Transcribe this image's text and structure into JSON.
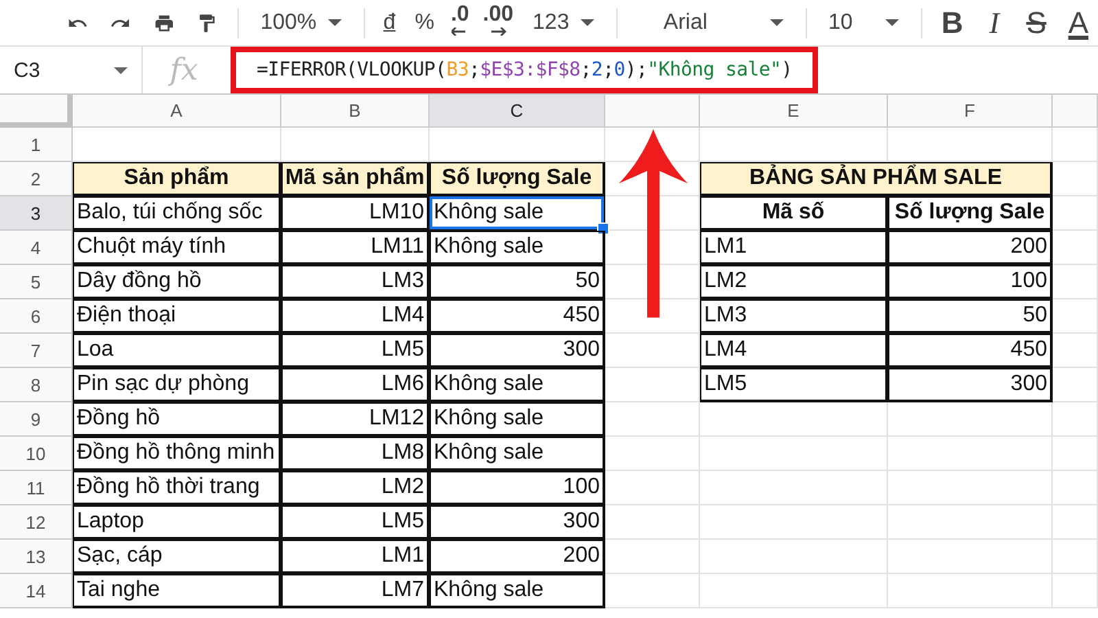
{
  "toolbar": {
    "zoom": "100%",
    "currency": "đ",
    "percent": "%",
    "decrease_decimals": ".0",
    "increase_decimals": ".00",
    "more_formats": "123",
    "font": "Arial",
    "font_size": "10",
    "bold": "B",
    "italic": "I",
    "strikethrough": "S",
    "text_color": "A"
  },
  "formula_bar": {
    "name_box": "C3",
    "fx": "fx",
    "formula": [
      {
        "text": "=IFERROR(VLOOKUP(",
        "color": "#202124"
      },
      {
        "text": "B3",
        "color": "#f09a2a"
      },
      {
        "text": ";",
        "color": "#202124"
      },
      {
        "text": "$E$3:$F$8",
        "color": "#8e44ad"
      },
      {
        "text": ";",
        "color": "#202124"
      },
      {
        "text": "2",
        "color": "#1a56c4"
      },
      {
        "text": ";",
        "color": "#202124"
      },
      {
        "text": "0",
        "color": "#1a56c4"
      },
      {
        "text": ");",
        "color": "#202124"
      },
      {
        "text": "\"Không sale\"",
        "color": "#188038"
      },
      {
        "text": ")",
        "color": "#202124"
      }
    ]
  },
  "column_headers": [
    {
      "label": "A",
      "selected": false
    },
    {
      "label": "B",
      "selected": false
    },
    {
      "label": "C",
      "selected": true
    },
    {
      "selected": false
    },
    {
      "label": "E",
      "selected": false
    },
    {
      "label": "F",
      "selected": false
    }
  ],
  "row_headers": [
    {
      "label": "1",
      "selected": false
    },
    {
      "label": "2",
      "selected": false
    },
    {
      "label": "3",
      "selected": true
    },
    {
      "label": "4",
      "selected": false
    },
    {
      "label": "5",
      "selected": false
    },
    {
      "label": "6",
      "selected": false
    },
    {
      "label": "7",
      "selected": false
    },
    {
      "label": "8",
      "selected": false
    },
    {
      "label": "9",
      "selected": false
    },
    {
      "label": "10",
      "selected": false
    },
    {
      "label": "11",
      "selected": false
    },
    {
      "label": "12",
      "selected": false
    },
    {
      "label": "13",
      "selected": false
    },
    {
      "label": "14",
      "selected": false
    }
  ],
  "product_table": {
    "columns": [
      "Sản phẩm",
      "Mã sản phẩm",
      "Số lượng Sale"
    ],
    "rows": [
      {
        "product": "Balo, túi chống sốc",
        "code": "LM10",
        "sale": "Không sale",
        "kind": "text",
        "selected": true
      },
      {
        "product": "Chuột máy tính",
        "code": "LM11",
        "sale": "Không sale",
        "kind": "text",
        "selected": false
      },
      {
        "product": "Dây đồng hồ",
        "code": "LM3",
        "sale": "50",
        "kind": "number",
        "selected": false
      },
      {
        "product": "Điện thoại",
        "code": "LM4",
        "sale": "450",
        "kind": "number",
        "selected": false
      },
      {
        "product": "Loa",
        "code": "LM5",
        "sale": "300",
        "kind": "number",
        "selected": false
      },
      {
        "product": "Pin sạc dự phòng",
        "code": "LM6",
        "sale": "Không sale",
        "kind": "text",
        "selected": false
      },
      {
        "product": "Đồng hồ",
        "code": "LM12",
        "sale": "Không sale",
        "kind": "text",
        "selected": false
      },
      {
        "product": "Đồng hồ thông minh",
        "code": "LM8",
        "sale": "Không sale",
        "kind": "text",
        "selected": false
      },
      {
        "product": "Đồng hồ thời trang",
        "code": "LM2",
        "sale": "100",
        "kind": "number",
        "selected": false
      },
      {
        "product": "Laptop",
        "code": "LM5",
        "sale": "300",
        "kind": "number",
        "selected": false
      },
      {
        "product": "Sạc, cáp",
        "code": "LM1",
        "sale": "200",
        "kind": "number",
        "selected": false
      },
      {
        "product": "Tai nghe",
        "code": "LM7",
        "sale": "Không sale",
        "kind": "text",
        "selected": false
      }
    ]
  },
  "sale_table": {
    "title": "BẢNG SẢN PHẨM SALE",
    "columns": [
      "Mã số",
      "Số lượng Sale"
    ],
    "rows": [
      {
        "code": "LM1",
        "sale": "200"
      },
      {
        "code": "LM2",
        "sale": "100"
      },
      {
        "code": "LM3",
        "sale": "50"
      },
      {
        "code": "LM4",
        "sale": "450"
      },
      {
        "code": "LM5",
        "sale": "300"
      }
    ]
  }
}
